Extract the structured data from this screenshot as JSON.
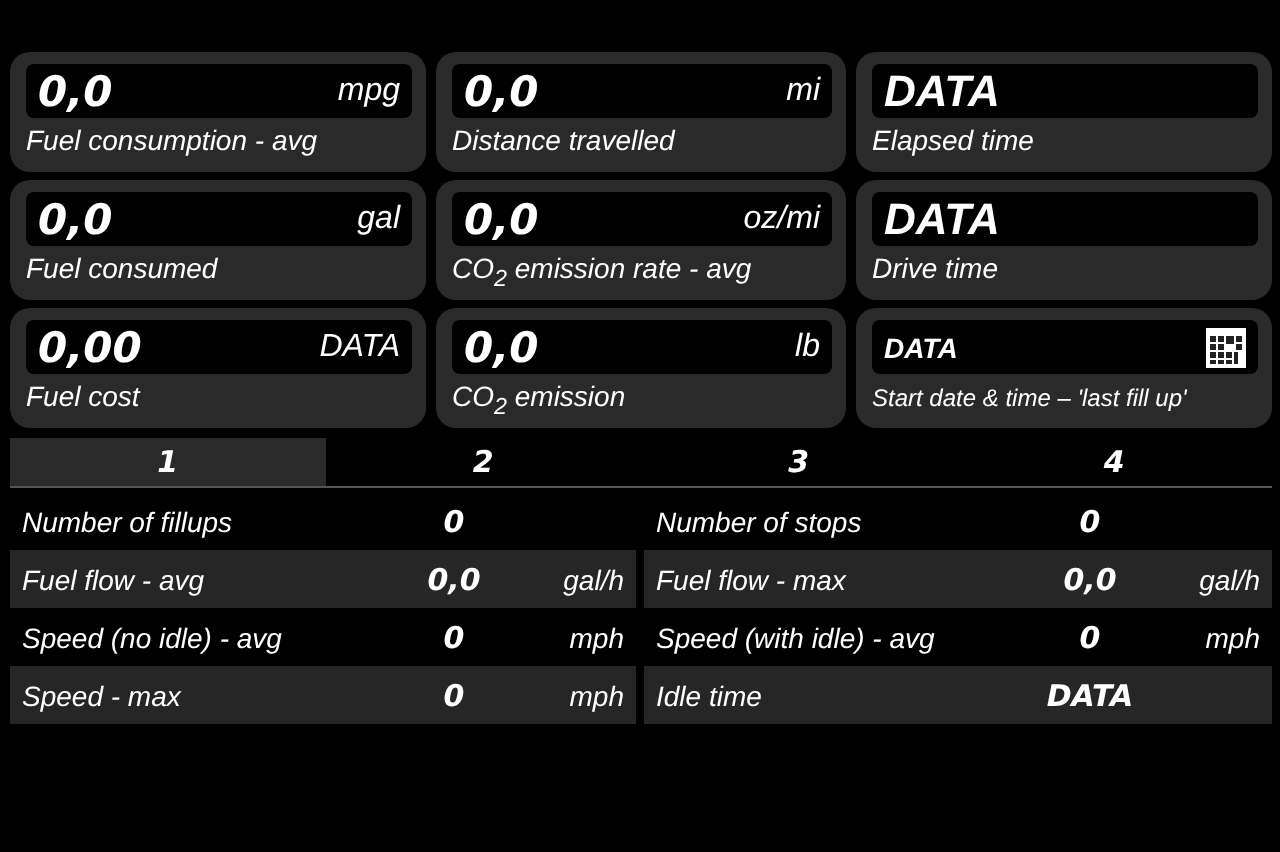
{
  "cards": [
    {
      "kind": "number",
      "value": "0,0",
      "unit": "mpg",
      "label": "Fuel consumption - avg"
    },
    {
      "kind": "number",
      "value": "0,0",
      "unit": "mi",
      "label": "Distance travelled"
    },
    {
      "kind": "text",
      "value": "DATA",
      "label": "Elapsed time"
    },
    {
      "kind": "number",
      "value": "0,0",
      "unit": "gal",
      "label": "Fuel consumed"
    },
    {
      "kind": "number",
      "value": "0,0",
      "unit": "oz/mi",
      "label": "CO$_{2}$ emission rate - avg"
    },
    {
      "kind": "text",
      "value": "DATA",
      "label": "Drive time"
    },
    {
      "kind": "number",
      "value": "0,00",
      "unit": "DATA",
      "label": "Fuel cost"
    },
    {
      "kind": "number",
      "value": "0,0",
      "unit": "lb",
      "label": "CO$_{2}$ emission"
    },
    {
      "kind": "date",
      "value": "DATA",
      "label": "Start date & time – 'last fill up'"
    }
  ],
  "tabs": [
    {
      "label": "1",
      "selected": true
    },
    {
      "label": "2",
      "selected": false
    },
    {
      "label": "3",
      "selected": false
    },
    {
      "label": "4",
      "selected": false
    }
  ],
  "stats": [
    {
      "label": "Number of fillups",
      "value": "0"
    },
    {
      "label": "Number of stops",
      "value": "0"
    },
    {
      "label": "Fuel flow - avg",
      "value": "0,0",
      "unit": "gal/h"
    },
    {
      "label": "Fuel flow - max",
      "value": "0,0",
      "unit": "gal/h"
    },
    {
      "label": "Speed (no idle) - avg",
      "value": "0",
      "unit": "mph"
    },
    {
      "label": "Speed (with idle) - avg",
      "value": "0",
      "unit": "mph"
    },
    {
      "label": "Speed - max",
      "value": "0",
      "unit": "mph"
    },
    {
      "label": "Idle time",
      "value": "DATA"
    }
  ]
}
